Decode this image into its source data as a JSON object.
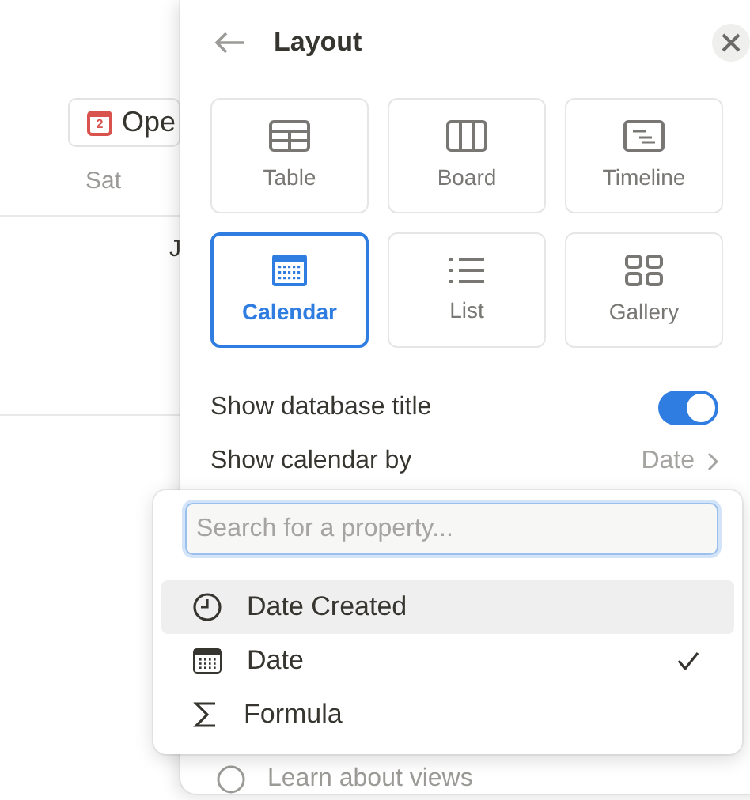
{
  "background": {
    "open_button": {
      "label": "Ope",
      "date_badge": "2"
    },
    "day_header": "Sat",
    "cell_text": "J"
  },
  "panel": {
    "title": "Layout",
    "layouts": [
      {
        "label": "Table",
        "selected": false
      },
      {
        "label": "Board",
        "selected": false
      },
      {
        "label": "Timeline",
        "selected": false
      },
      {
        "label": "Calendar",
        "selected": true
      },
      {
        "label": "List",
        "selected": false
      },
      {
        "label": "Gallery",
        "selected": false
      }
    ],
    "settings": [
      {
        "kind": "toggle",
        "label": "Show database title",
        "on": true
      },
      {
        "kind": "link",
        "label": "Show calendar by",
        "value": "Date"
      }
    ],
    "footer_link": "Learn about views"
  },
  "property_menu": {
    "search": {
      "placeholder": "Search for a property..."
    },
    "options": [
      {
        "label": "Date Created",
        "highlighted": true,
        "selected": false
      },
      {
        "label": "Date",
        "highlighted": false,
        "selected": true
      },
      {
        "label": "Formula",
        "highlighted": false,
        "selected": false
      }
    ]
  }
}
